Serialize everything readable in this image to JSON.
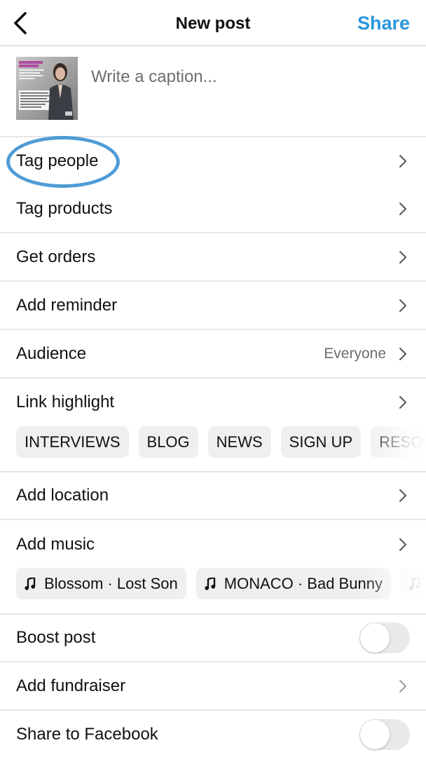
{
  "header": {
    "back_icon": "chevron-left-icon",
    "title": "New post",
    "share_label": "Share"
  },
  "caption": {
    "placeholder": "Write a caption...",
    "value": "",
    "thumbnail_alt": "Post image thumbnail: woman in a dark blazer with text overlay"
  },
  "rows": {
    "tag_people": {
      "label": "Tag people",
      "icon": "chevron-right-icon"
    },
    "tag_products": {
      "label": "Tag products",
      "icon": "chevron-right-icon"
    },
    "get_orders": {
      "label": "Get orders",
      "icon": "chevron-right-icon"
    },
    "add_reminder": {
      "label": "Add reminder",
      "icon": "chevron-right-icon"
    },
    "audience": {
      "label": "Audience",
      "value": "Everyone",
      "icon": "chevron-right-icon"
    },
    "link_highlight": {
      "label": "Link highlight",
      "icon": "chevron-right-icon"
    },
    "add_location": {
      "label": "Add location",
      "icon": "chevron-right-icon"
    },
    "add_music": {
      "label": "Add music",
      "icon": "chevron-right-icon"
    },
    "boost_post": {
      "label": "Boost post",
      "toggle_on": false
    },
    "add_fundraiser": {
      "label": "Add fundraiser",
      "icon": "chevron-right-icon"
    },
    "share_to_facebook": {
      "label": "Share to Facebook",
      "toggle_on": false
    }
  },
  "link_chips": [
    "INTERVIEWS",
    "BLOG",
    "NEWS",
    "SIGN UP",
    "RESOURCES"
  ],
  "music_chips": [
    {
      "icon": "music-note-icon",
      "label": "Blossom · Lost Son"
    },
    {
      "icon": "music-note-icon",
      "label": "MONACO · Bad Bunny"
    },
    {
      "icon": "music-note-icon",
      "label": ""
    }
  ],
  "annotation": {
    "highlighted_item": "Tag people",
    "ring_color": "#4f9bd6"
  },
  "colors": {
    "accent": "#2a96dc",
    "chip_bg": "#efefef",
    "divider": "#e6e6e6",
    "secondary_text": "#6d6d6d"
  }
}
